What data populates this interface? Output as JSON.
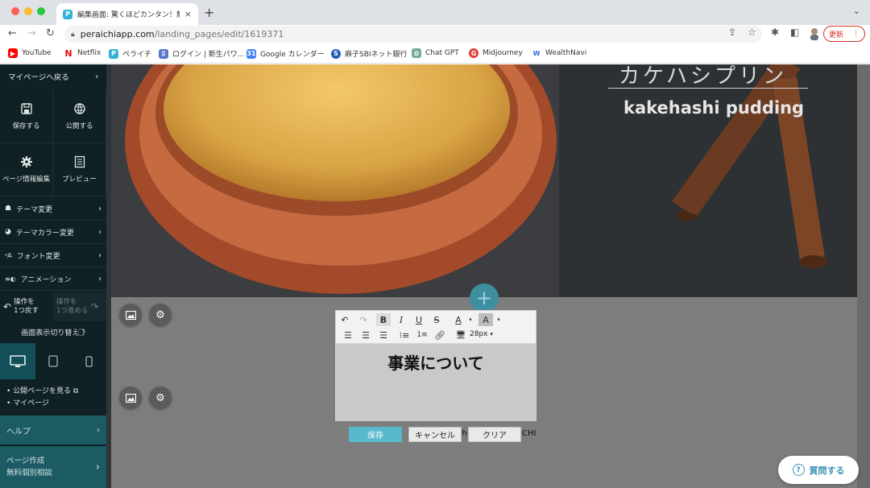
{
  "browser": {
    "tab_title": "編集画面: 驚くほどカンタン！無料",
    "tab_close": "×",
    "new_tab": "+",
    "url_host": "peraichiapp.com",
    "url_path": "/landing_pages/edit/1619371",
    "update_label": "更新",
    "bookmarks": [
      {
        "label": "YouTube",
        "icon": "youtube-icon",
        "color": "#ff0000"
      },
      {
        "label": "Netflix",
        "icon": "netflix-icon",
        "color": "#e50914"
      },
      {
        "label": "ペライチ",
        "icon": "peraichi-icon",
        "color": "#33b0d8"
      },
      {
        "label": "ログイン | 新生パワ...",
        "icon": "login-icon",
        "color": "#5a77c9"
      },
      {
        "label": "Google カレンダー",
        "icon": "calendar-icon",
        "color": "#4285f4"
      },
      {
        "label": "麻子SBIネット銀行",
        "icon": "bank-icon",
        "color": "#1d5db5"
      },
      {
        "label": "Chat GPT",
        "icon": "chatgpt-icon",
        "color": "#74aa9c"
      },
      {
        "label": "Midjourney",
        "icon": "midjourney-icon",
        "color": "#e23b3b"
      },
      {
        "label": "WealthNavi",
        "icon": "wealthnavi-icon",
        "color": "#2f6ad8"
      }
    ]
  },
  "sidebar": {
    "back_label": "マイページへ戻る",
    "actions": [
      {
        "label": "保存する",
        "icon": "save-icon"
      },
      {
        "label": "公開する",
        "icon": "publish-icon"
      },
      {
        "label": "ページ情報編集",
        "icon": "gear-icon"
      },
      {
        "label": "プレビュー",
        "icon": "preview-icon"
      }
    ],
    "menu": [
      {
        "label": "テーマ変更",
        "icon": "theme-icon"
      },
      {
        "label": "テーマカラー変更",
        "icon": "palette-icon"
      },
      {
        "label": "フォント変更",
        "icon": "font-icon"
      },
      {
        "label": "アニメーション",
        "icon": "animation-icon"
      }
    ],
    "undo_label": "操作を\n1つ戻す",
    "redo_label": "操作を\n1つ進める",
    "switch_label": "画面表示切り替え",
    "links": [
      "公開ページを見る",
      "マイページ"
    ],
    "help_label": "ヘルプ",
    "consult_label_1": "ページ作成",
    "consult_label_2": "無料個別相談"
  },
  "hero": {
    "title_jp": "カケハシプリン",
    "title_en": "kakehashi pudding"
  },
  "editor": {
    "font_size": "28px",
    "heading": "事業について",
    "save_label": "保存",
    "cancel_label": "キャンセル",
    "clear_label": "クリア",
    "bg_text_left": "gh",
    "bg_text_right": "CHI"
  },
  "ask_label": "質問する",
  "colors": {
    "sidebar_bg": "#0f2124",
    "accent": "#59b8cb",
    "update_red": "#d93025"
  }
}
